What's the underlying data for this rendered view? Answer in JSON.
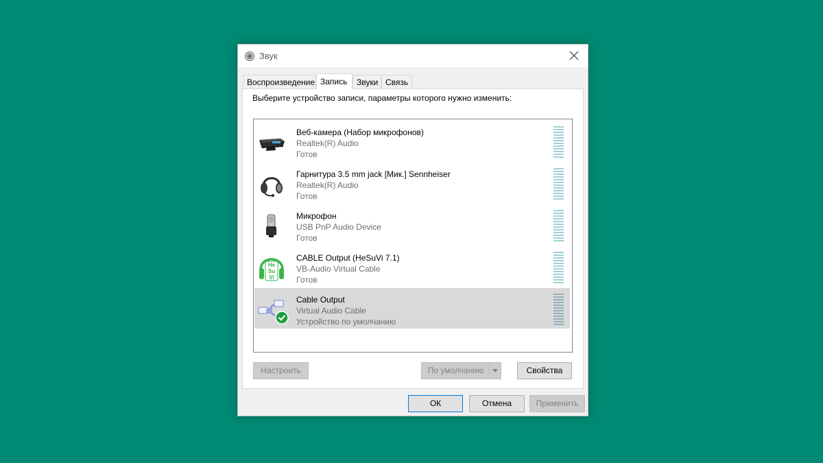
{
  "window": {
    "title": "Звук"
  },
  "tabs": [
    {
      "label": "Воспроизведение"
    },
    {
      "label": "Запись"
    },
    {
      "label": "Звуки"
    },
    {
      "label": "Связь"
    }
  ],
  "active_tab": "Запись",
  "instruction": "Выберите устройство записи, параметры которого нужно изменить:",
  "devices": [
    {
      "name": "Веб-камера (Набор микрофонов)",
      "driver": "Realtek(R) Audio",
      "status": "Готов",
      "icon": "webcam-icon"
    },
    {
      "name": "Гарнитура 3.5 mm jack [Мик.] Sennheiser",
      "driver": "Realtek(R) Audio",
      "status": "Готов",
      "icon": "headset-icon"
    },
    {
      "name": "Микрофон",
      "driver": "USB PnP Audio Device",
      "status": "Готов",
      "icon": "microphone-icon"
    },
    {
      "name": "CABLE Output (HeSuVi 7.1)",
      "driver": "VB-Audio Virtual Cable",
      "status": "Готов",
      "icon": "hesuvi-headphones-icon"
    },
    {
      "name": "Cable Output",
      "driver": "Virtual Audio Cable",
      "status": "Устройство по умолчанию",
      "icon": "virtual-cable-icon",
      "selected": true,
      "default": true
    }
  ],
  "hesuvi_icon_text": [
    "He",
    "Su",
    "Vi"
  ],
  "buttons": {
    "configure": "Настроить",
    "set_default": "По умолчанию",
    "properties": "Свойства",
    "ok": "ОК",
    "cancel": "Отмена",
    "apply": "Применить"
  },
  "colors": {
    "background": "#008a73",
    "selected_row": "#d9d9d9",
    "default_check": "#1e9e3e",
    "meter": "#9fd0d8"
  }
}
